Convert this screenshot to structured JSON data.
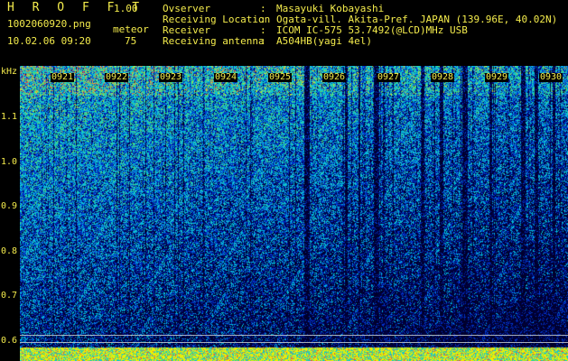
{
  "app": {
    "title": "H R O F F T",
    "version": "1.00"
  },
  "file": {
    "name": "1002060920.png",
    "datetime": "10.02.06 09:20",
    "mode": "meteor",
    "count": "75"
  },
  "info": [
    {
      "label": "Ovserver",
      "value": "Masayuki Kobayashi"
    },
    {
      "label": "Receiving Location",
      "value": "Ogata-vill. Akita-Pref. JAPAN (139.96E, 40.02N)"
    },
    {
      "label": "Receiver",
      "value": "ICOM IC-575 53.7492(@LCD)MHz USB"
    },
    {
      "label": "Receiving antenna",
      "value": "A504HB(yagi 4el)"
    }
  ],
  "axis": {
    "y_unit": "kHz",
    "y_ticks": [
      "1.1",
      "1.0",
      "0.9",
      "0.8",
      "0.7",
      "0.6"
    ],
    "x_ticks": [
      "0921",
      "0922",
      "0923",
      "0924",
      "0925",
      "0926",
      "0927",
      "0928",
      "0929",
      "0930"
    ]
  },
  "colors": {
    "text": "#f4ec4c",
    "background": "#000000"
  }
}
